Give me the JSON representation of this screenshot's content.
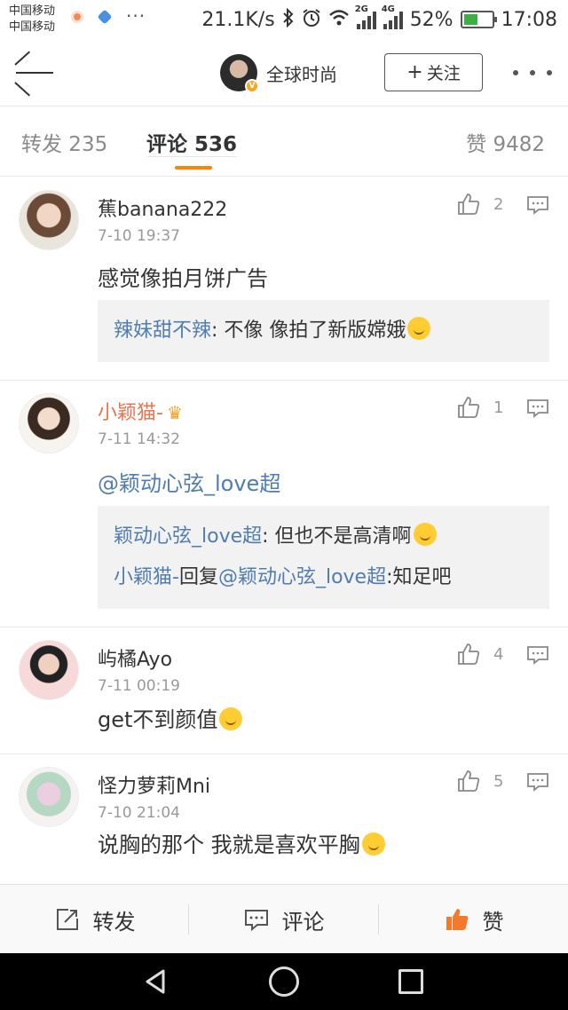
{
  "status_bar": {
    "carrier1": "中国移动",
    "carrier2": "中国移动",
    "dots": "···",
    "speed": "21.1K/s",
    "net1": "2G",
    "net2": "4G",
    "battery": "52%",
    "battery_level": 0.52,
    "time": "17:08"
  },
  "header": {
    "account_name": "全球时尚",
    "follow_label": "关注",
    "follow_plus": "+"
  },
  "tabs": {
    "repost": "转发 235",
    "comment": "评论 536",
    "like": "赞 9482"
  },
  "comments": [
    {
      "name": "蕉banana222",
      "time": "7-10 19:37",
      "likes": "2",
      "text": "感觉像拍月饼广告",
      "replies": [
        {
          "name": "辣妹甜不辣",
          "text": ": 不像    像拍了新版嫦娥"
        }
      ]
    },
    {
      "name": "小颖猫-",
      "time": "7-11 14:32",
      "likes": "1",
      "text": "@颖动心弦_love超",
      "replies": [
        {
          "name": "颖动心弦_love超",
          "text": ": 但也不是高清啊"
        },
        {
          "name": "小颖猫-",
          "mid": "回复",
          "mention": "@颖动心弦_love超",
          "text": ":知足吧"
        }
      ]
    },
    {
      "name": "屿橘Ayo",
      "time": "7-11 00:19",
      "likes": "4",
      "text": "get不到颜值"
    },
    {
      "name": "怪力萝莉Mni",
      "time": "7-10 21:04",
      "likes": "5",
      "text": "说胸的那个 我就是喜欢平胸"
    }
  ],
  "action_bar": {
    "repost": "转发",
    "comment": "评论",
    "like": "赞"
  },
  "colors": {
    "accent": "#ff8200",
    "link": "#507daf",
    "vip_name": "#eb7350"
  }
}
